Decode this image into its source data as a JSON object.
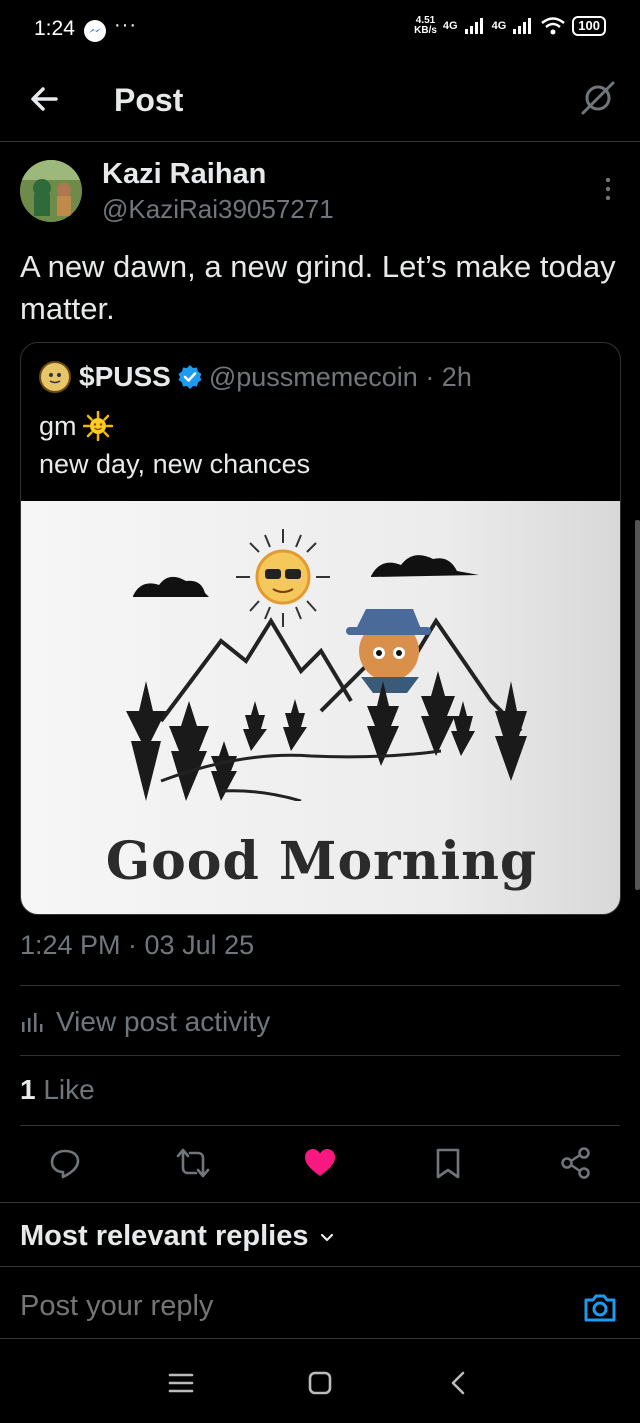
{
  "status_bar": {
    "time": "1:24",
    "dots": "···",
    "net_speed_value": "4.51",
    "net_speed_unit": "KB/s",
    "network_1": "4G",
    "network_2": "4G",
    "battery": "100"
  },
  "header": {
    "title": "Post"
  },
  "post": {
    "author_name": "Kazi Raihan",
    "author_handle": "@KaziRai39057271",
    "text": "A new dawn, a new grind. Let’s make today matter.",
    "timestamp": "1:24 PM · 03 Jul 25"
  },
  "quoted_post": {
    "name": "$PUSS",
    "handle_time": "@pussmemecoin · 2h",
    "line1": "gm",
    "line2": "new day, new chances",
    "image_caption": "Good Morning"
  },
  "activity": {
    "label": "View post activity"
  },
  "likes": {
    "count": "1",
    "label": "Like"
  },
  "replies": {
    "sort_label": "Most relevant replies",
    "input_placeholder": "Post your reply"
  },
  "colors": {
    "background": "#000000",
    "text_primary": "#e7e9ea",
    "text_secondary": "#71767b",
    "divider": "#2f3336",
    "like_pink": "#f91880",
    "accent_blue": "#1d9bf0"
  },
  "icons": {
    "back": "arrow-left-icon",
    "grok": "grok-icon",
    "more": "more-vertical-icon",
    "verified": "verified-badge-icon",
    "reply": "reply-icon",
    "repost": "repost-icon",
    "like": "heart-icon",
    "bookmark": "bookmark-icon",
    "share": "share-icon",
    "camera": "camera-icon",
    "activity": "bar-chart-icon"
  }
}
